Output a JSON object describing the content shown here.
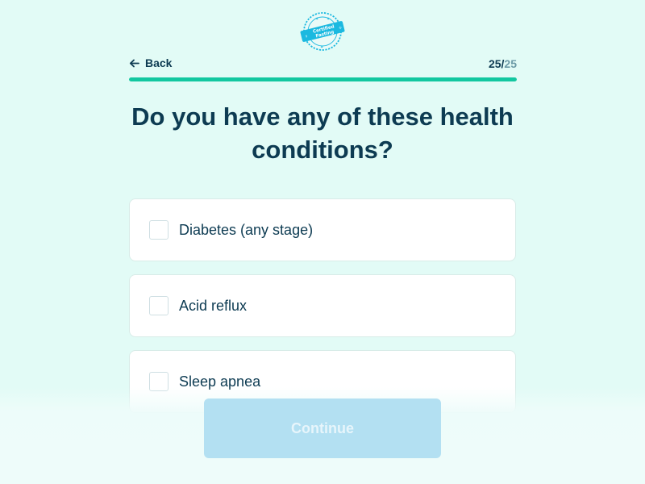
{
  "logo": {
    "line1": "Certified",
    "line2": "Fasting",
    "accent": "#1bb9e0"
  },
  "nav": {
    "back_label": "Back",
    "step_current": "25",
    "step_separator": "/",
    "step_total": "25"
  },
  "progress": {
    "fraction": 1.0,
    "color": "#12c7a0"
  },
  "question": {
    "title": "Do you have any of these health conditions?"
  },
  "options": [
    {
      "label": "Diabetes (any stage)",
      "checked": false
    },
    {
      "label": "Acid reflux",
      "checked": false
    },
    {
      "label": "Sleep apnea",
      "checked": false
    }
  ],
  "continue_button": {
    "label": "Continue",
    "disabled": true
  },
  "colors": {
    "background": "#e2fbf6",
    "text": "#0d3b52",
    "button_disabled": "#b3e0f2"
  }
}
